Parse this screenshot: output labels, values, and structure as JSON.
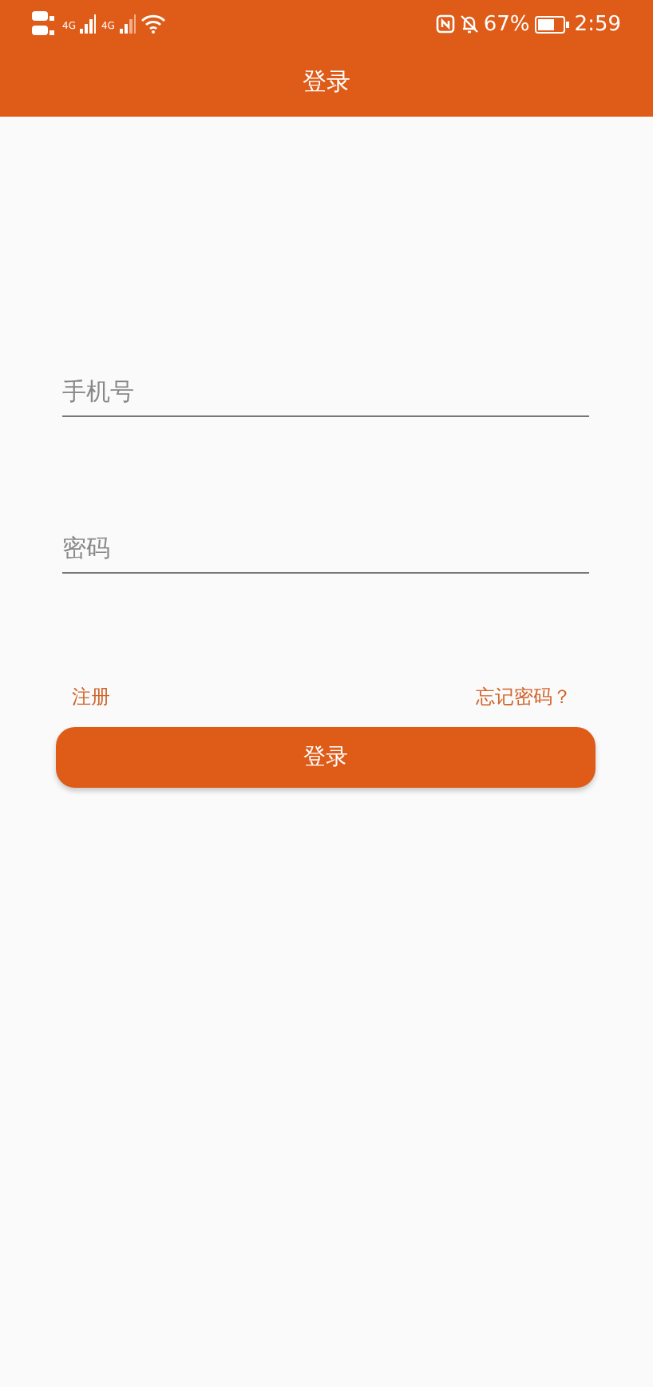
{
  "status_bar": {
    "network": "4G",
    "network_2": "4G",
    "battery": "67%",
    "time": "2:59"
  },
  "title": "登录",
  "fields": [
    {
      "placeholder": "手机号"
    },
    {
      "placeholder": "密码"
    }
  ],
  "links": {
    "register": "注册",
    "forgot": "忘记密码？"
  },
  "login_button": "登录"
}
